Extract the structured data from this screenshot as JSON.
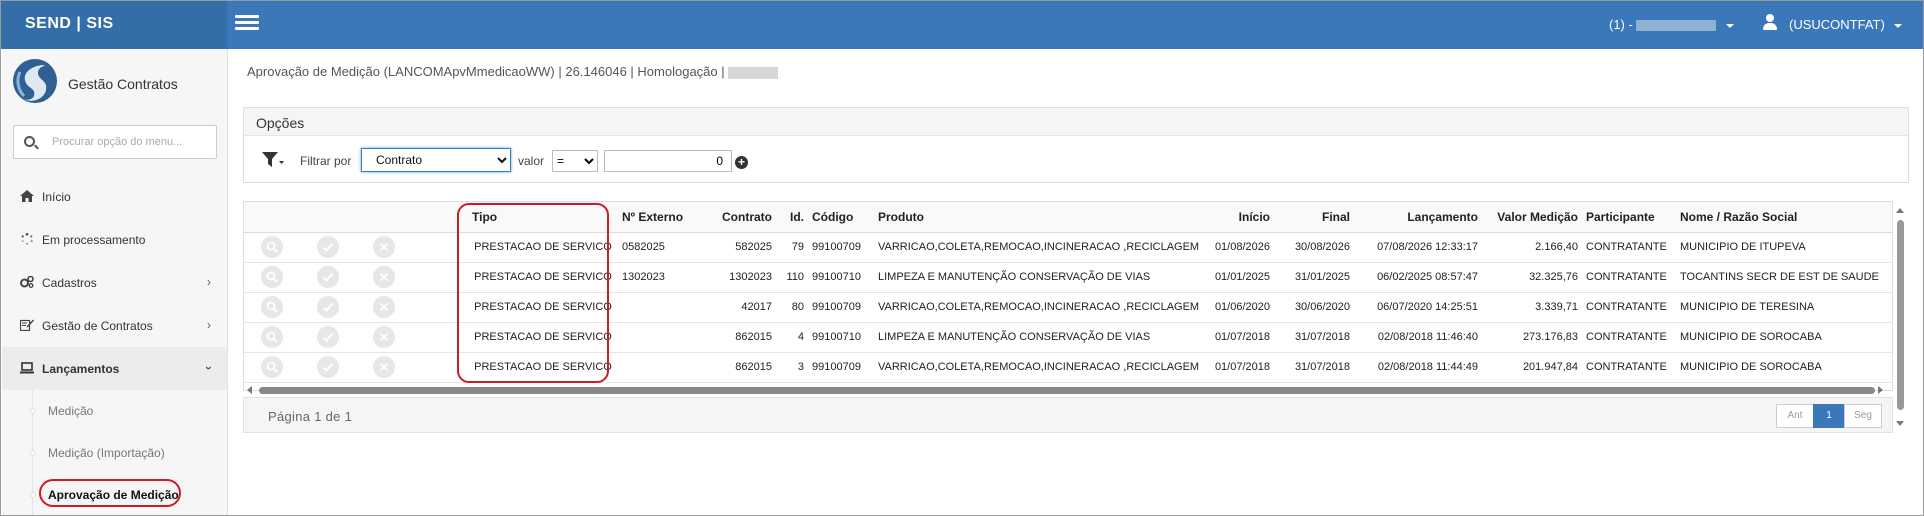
{
  "header": {
    "brand": "SEND | SIS",
    "session_label": "(1) -",
    "user_label": "(USUCONTFAT)"
  },
  "sidebar": {
    "app_name": "Gestão Contratos",
    "search_placeholder": "Procurar opção do menu...",
    "items": [
      {
        "label": "Início",
        "icon": "home-icon"
      },
      {
        "label": "Em processamento",
        "icon": "spinner-icon"
      },
      {
        "label": "Cadastros",
        "icon": "gears-icon"
      },
      {
        "label": "Gestão de Contratos",
        "icon": "edit-icon"
      },
      {
        "label": "Lançamentos",
        "icon": "laptop-icon"
      }
    ],
    "sub_items": [
      {
        "label": "Medição"
      },
      {
        "label": "Medição (Importação)"
      },
      {
        "label": "Aprovação de Medição"
      }
    ]
  },
  "breadcrumb": "Aprovação de Medição (LANCOMApvMmedicaoWW) | 26.146046 | Homologação |",
  "options": {
    "title": "Opções",
    "filter_label": "Filtrar por",
    "filter_value": "Contrato",
    "valor_label": "valor",
    "operator": "=",
    "value": "0"
  },
  "table": {
    "columns": [
      "Tipo",
      "Nº Externo",
      "Contrato",
      "Id.",
      "Código",
      "Produto",
      "Início",
      "Final",
      "Lançamento",
      "Valor Medição",
      "Participante",
      "Nome / Razão Social"
    ],
    "rows": [
      {
        "tipo": "PRESTACAO DE SERVICO",
        "externo": "0582025",
        "contrato": "582025",
        "id": "79",
        "codigo": "99100709",
        "produto": "VARRICAO,COLETA,REMOCAO,INCINERACAO ,RECICLAGEM",
        "inicio": "01/08/2026",
        "final": "30/08/2026",
        "lancamento": "07/08/2026 12:33:17",
        "valor": "2.166,40",
        "participante": "CONTRATANTE",
        "nome": "MUNICIPIO DE ITUPEVA"
      },
      {
        "tipo": "PRESTACAO DE SERVICO",
        "externo": "1302023",
        "contrato": "1302023",
        "id": "110",
        "codigo": "99100710",
        "produto": "LIMPEZA E MANUTENÇÃO CONSERVAÇÃO DE VIAS",
        "inicio": "01/01/2025",
        "final": "31/01/2025",
        "lancamento": "06/02/2025 08:57:47",
        "valor": "32.325,76",
        "participante": "CONTRATANTE",
        "nome": "TOCANTINS SECR DE EST DE SAUDE"
      },
      {
        "tipo": "PRESTACAO DE SERVICO",
        "externo": "",
        "contrato": "42017",
        "id": "80",
        "codigo": "99100709",
        "produto": "VARRICAO,COLETA,REMOCAO,INCINERACAO ,RECICLAGEM",
        "inicio": "01/06/2020",
        "final": "30/06/2020",
        "lancamento": "06/07/2020 14:25:51",
        "valor": "3.339,71",
        "participante": "CONTRATANTE",
        "nome": "MUNICIPIO DE TERESINA"
      },
      {
        "tipo": "PRESTACAO DE SERVICO",
        "externo": "",
        "contrato": "862015",
        "id": "4",
        "codigo": "99100710",
        "produto": "LIMPEZA E MANUTENÇÃO CONSERVAÇÃO DE VIAS",
        "inicio": "01/07/2018",
        "final": "31/07/2018",
        "lancamento": "02/08/2018 11:46:40",
        "valor": "273.176,83",
        "participante": "CONTRATANTE",
        "nome": "MUNICIPIO DE SOROCABA"
      },
      {
        "tipo": "PRESTACAO DE SERVICO",
        "externo": "",
        "contrato": "862015",
        "id": "3",
        "codigo": "99100709",
        "produto": "VARRICAO,COLETA,REMOCAO,INCINERACAO ,RECICLAGEM",
        "inicio": "01/07/2018",
        "final": "31/07/2018",
        "lancamento": "02/08/2018 11:44:49",
        "valor": "201.947,84",
        "participante": "CONTRATANTE",
        "nome": "MUNICIPIO DE SOROCABA"
      }
    ]
  },
  "pager": {
    "text": "Página 1 de 1",
    "prev": "Ant",
    "current": "1",
    "next": "Seg"
  },
  "colors": {
    "topbar": "#3a78b9",
    "highlight": "#d01a26"
  }
}
